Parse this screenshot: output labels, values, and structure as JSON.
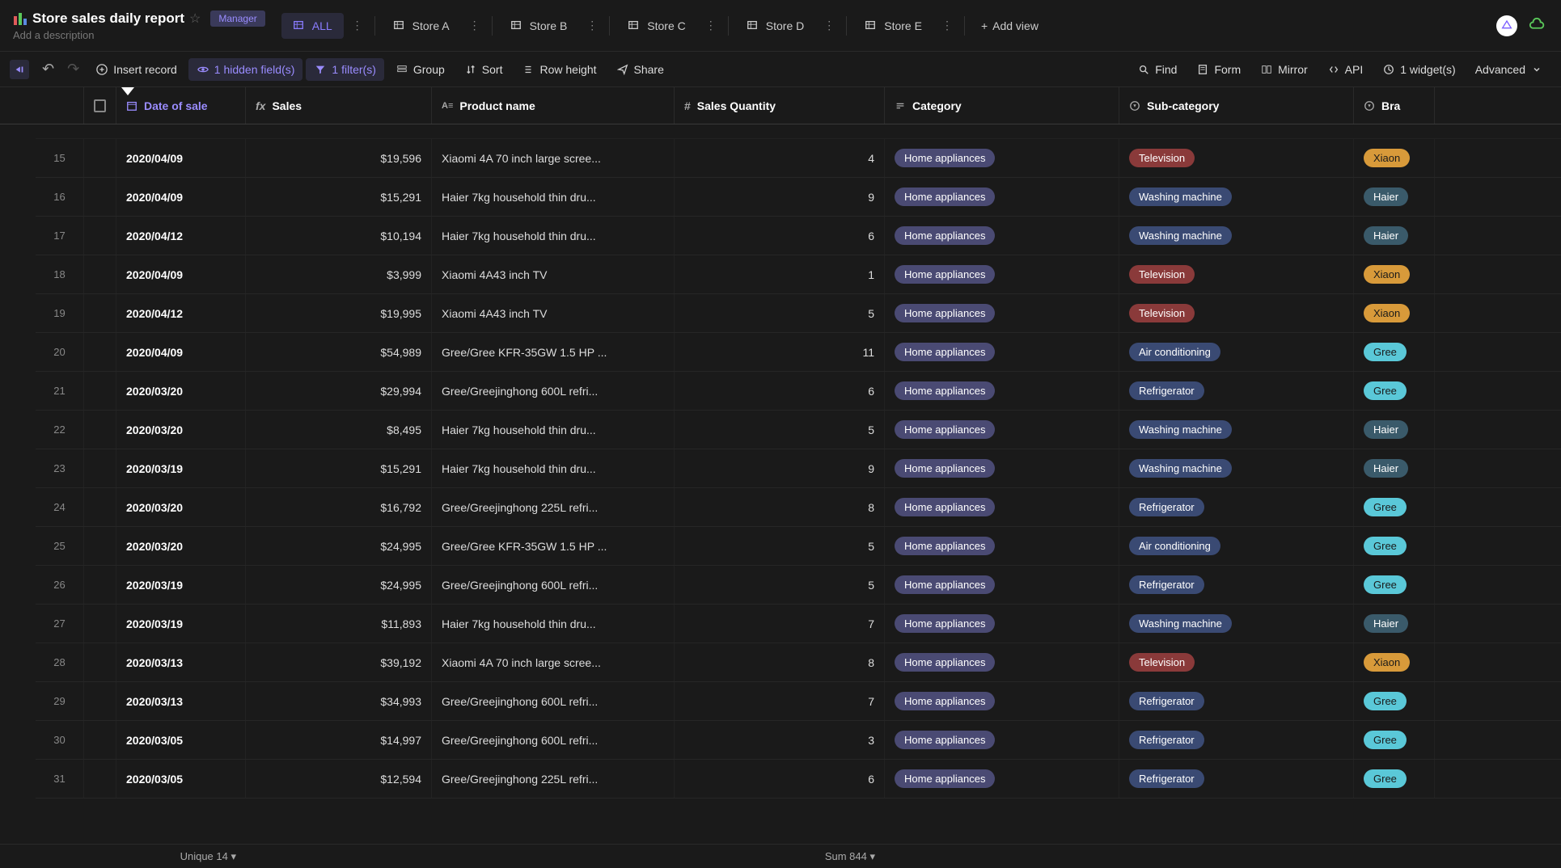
{
  "header": {
    "title": "Store sales daily report",
    "role": "Manager",
    "description_placeholder": "Add a description"
  },
  "views": {
    "active": "ALL",
    "tabs": [
      "ALL",
      "Store A",
      "Store B",
      "Store C",
      "Store D",
      "Store E"
    ],
    "add_label": "Add view"
  },
  "toolbar": {
    "insert_record": "Insert record",
    "hidden_fields": "1 hidden field(s)",
    "filters": "1 filter(s)",
    "group": "Group",
    "sort": "Sort",
    "row_height": "Row height",
    "share": "Share",
    "find": "Find",
    "form": "Form",
    "mirror": "Mirror",
    "api": "API",
    "widgets": "1 widget(s)",
    "advanced": "Advanced"
  },
  "columns": {
    "date": "Date of sale",
    "sales": "Sales",
    "product": "Product name",
    "qty": "Sales Quantity",
    "category": "Category",
    "subcategory": "Sub-category",
    "brand": "Bra"
  },
  "rows": [
    {
      "n": 15,
      "date": "2020/04/09",
      "sales": "$19,596",
      "product": "Xiaomi 4A 70 inch large scree...",
      "qty": 4,
      "category": "Home appliances",
      "subcat": "Television",
      "brand": "Xiaon"
    },
    {
      "n": 16,
      "date": "2020/04/09",
      "sales": "$15,291",
      "product": "Haier 7kg household thin dru...",
      "qty": 9,
      "category": "Home appliances",
      "subcat": "Washing machine",
      "brand": "Haier"
    },
    {
      "n": 17,
      "date": "2020/04/12",
      "sales": "$10,194",
      "product": "Haier 7kg household thin dru...",
      "qty": 6,
      "category": "Home appliances",
      "subcat": "Washing machine",
      "brand": "Haier"
    },
    {
      "n": 18,
      "date": "2020/04/09",
      "sales": "$3,999",
      "product": "Xiaomi 4A43 inch TV",
      "qty": 1,
      "category": "Home appliances",
      "subcat": "Television",
      "brand": "Xiaon"
    },
    {
      "n": 19,
      "date": "2020/04/12",
      "sales": "$19,995",
      "product": "Xiaomi 4A43 inch TV",
      "qty": 5,
      "category": "Home appliances",
      "subcat": "Television",
      "brand": "Xiaon"
    },
    {
      "n": 20,
      "date": "2020/04/09",
      "sales": "$54,989",
      "product": "Gree/Gree KFR-35GW 1.5 HP ...",
      "qty": 11,
      "category": "Home appliances",
      "subcat": "Air conditioning",
      "brand": "Gree"
    },
    {
      "n": 21,
      "date": "2020/03/20",
      "sales": "$29,994",
      "product": "Gree/Greejinghong 600L refri...",
      "qty": 6,
      "category": "Home appliances",
      "subcat": "Refrigerator",
      "brand": "Gree"
    },
    {
      "n": 22,
      "date": "2020/03/20",
      "sales": "$8,495",
      "product": "Haier 7kg household thin dru...",
      "qty": 5,
      "category": "Home appliances",
      "subcat": "Washing machine",
      "brand": "Haier"
    },
    {
      "n": 23,
      "date": "2020/03/19",
      "sales": "$15,291",
      "product": "Haier 7kg household thin dru...",
      "qty": 9,
      "category": "Home appliances",
      "subcat": "Washing machine",
      "brand": "Haier"
    },
    {
      "n": 24,
      "date": "2020/03/20",
      "sales": "$16,792",
      "product": "Gree/Greejinghong 225L refri...",
      "qty": 8,
      "category": "Home appliances",
      "subcat": "Refrigerator",
      "brand": "Gree"
    },
    {
      "n": 25,
      "date": "2020/03/20",
      "sales": "$24,995",
      "product": "Gree/Gree KFR-35GW 1.5 HP ...",
      "qty": 5,
      "category": "Home appliances",
      "subcat": "Air conditioning",
      "brand": "Gree"
    },
    {
      "n": 26,
      "date": "2020/03/19",
      "sales": "$24,995",
      "product": "Gree/Greejinghong 600L refri...",
      "qty": 5,
      "category": "Home appliances",
      "subcat": "Refrigerator",
      "brand": "Gree"
    },
    {
      "n": 27,
      "date": "2020/03/19",
      "sales": "$11,893",
      "product": "Haier 7kg household thin dru...",
      "qty": 7,
      "category": "Home appliances",
      "subcat": "Washing machine",
      "brand": "Haier"
    },
    {
      "n": 28,
      "date": "2020/03/13",
      "sales": "$39,192",
      "product": "Xiaomi 4A 70 inch large scree...",
      "qty": 8,
      "category": "Home appliances",
      "subcat": "Television",
      "brand": "Xiaon"
    },
    {
      "n": 29,
      "date": "2020/03/13",
      "sales": "$34,993",
      "product": "Gree/Greejinghong 600L refri...",
      "qty": 7,
      "category": "Home appliances",
      "subcat": "Refrigerator",
      "brand": "Gree"
    },
    {
      "n": 30,
      "date": "2020/03/05",
      "sales": "$14,997",
      "product": "Gree/Greejinghong 600L refri...",
      "qty": 3,
      "category": "Home appliances",
      "subcat": "Refrigerator",
      "brand": "Gree"
    },
    {
      "n": 31,
      "date": "2020/03/05",
      "sales": "$12,594",
      "product": "Gree/Greejinghong 225L refri...",
      "qty": 6,
      "category": "Home appliances",
      "subcat": "Refrigerator",
      "brand": "Gree"
    }
  ],
  "footer": {
    "unique": "Unique 14 ▾",
    "sum": "Sum 844 ▾"
  },
  "tag_classes": {
    "Television": "television",
    "Washing machine": "washing-machine",
    "Air conditioning": "air-conditioning",
    "Refrigerator": "refrigerator",
    "Home appliances": "home-appliances",
    "Xiaon": "xiaomi",
    "Haier": "haier",
    "Gree": "gree"
  }
}
